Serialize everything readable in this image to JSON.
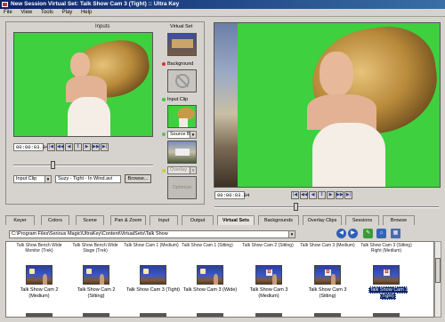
{
  "window": {
    "title": "New Session  Virtual Set: Talk Show Cam 3 (Tight) :: Ultra Key"
  },
  "menu": [
    "File",
    "View",
    "Tools",
    "Play",
    "Help"
  ],
  "inputs_panel": {
    "title": "Inputs",
    "timecode": "00:00:03.04",
    "source_type": "Input Clip",
    "clip_name": "Suzy - Tight - In Wind.avi",
    "browse_label": "Browse...",
    "slider_value_pct": 24
  },
  "virtual_set_column": {
    "title": "Virtual Set",
    "background_label": "Background",
    "input_clip_label": "Input Clip",
    "source_label": "Source B",
    "overlay_label": "Overlay",
    "optimize_label": "Optimize"
  },
  "output_panel": {
    "timecode": "00:00:03.04",
    "slider_value_pct": 36
  },
  "tabs": [
    "Keyer",
    "Colors",
    "Scene",
    "Pan & Zoom",
    "Input",
    "Output",
    "Virtual Sets",
    "Backgrounds",
    "Overlay Clips",
    "Sessions",
    "Browse"
  ],
  "active_tab": "Virtual Sets",
  "browser": {
    "path": "C:\\Program Files\\Serious Magic\\UltraKey\\Content\\VirtualSets\\Talk Show",
    "top_row": [
      "Talk Show Bench Wide Monitor (Trek)",
      "Talk Show Bench Wide Stage (Trek)",
      "Talk Show Cam 1 (Medium)",
      "Talk Show Cam 1 (Sitting)",
      "Talk Show Cam 2 (Sitting)",
      "Talk Show Cam 3 (Medium)",
      "Talk Show Cam 3 (Sitting) Right (Medium)"
    ],
    "items": [
      "Talk Show Cam 2 (Medium)",
      "Talk Show Cam 2 (Sitting)",
      "Talk Show Cam 3 (Tight)",
      "Talk Show Cam 3 (Wide)",
      "Talk Show Cam 3 (Medium)",
      "Talk Show Cam 3 (Sitting)",
      "Talk Show Cam 3 (Tight)"
    ],
    "selected_index": 6
  },
  "colors": {
    "green_screen": "#3ed03e",
    "title_bar": "#0a246a",
    "selection": "#0a246a"
  }
}
